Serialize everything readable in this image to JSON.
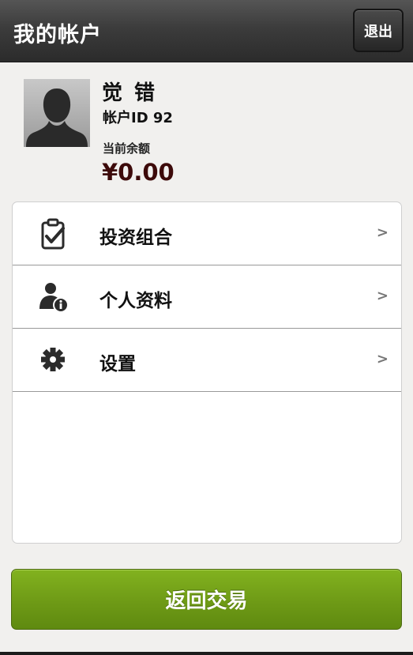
{
  "header": {
    "title": "我的帐户",
    "logout_label": "退出"
  },
  "profile": {
    "name": "觉 错",
    "account_id": "帐户ID 92",
    "balance_label": "当前余额",
    "balance_value": "¥0.00"
  },
  "menu": {
    "items": [
      {
        "label": "投资组合",
        "icon": "clipboard-check-icon",
        "chevron": ">"
      },
      {
        "label": "个人资料",
        "icon": "user-info-icon",
        "chevron": ">"
      },
      {
        "label": "设置",
        "icon": "gear-icon",
        "chevron": ">"
      }
    ]
  },
  "footer": {
    "back_label": "返回交易"
  },
  "colors": {
    "accent_green": "#6e9a16",
    "header_dark": "#3c3c3c",
    "balance": "#3d0a0a",
    "background": "#f1f0ee"
  }
}
